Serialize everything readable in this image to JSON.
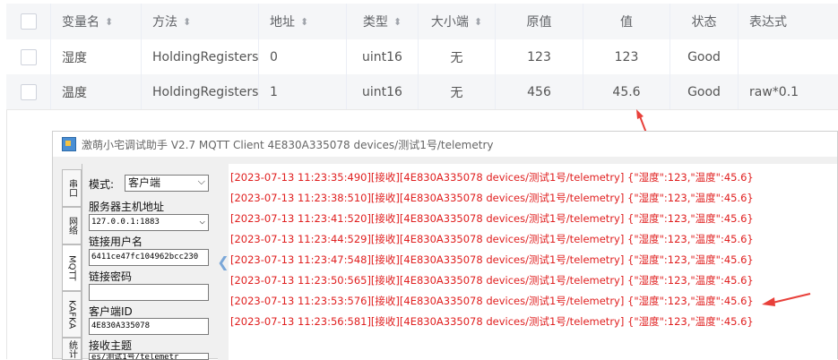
{
  "table": {
    "headers": [
      "变量名",
      "方法",
      "地址",
      "类型",
      "大小端",
      "原值",
      "值",
      "状态",
      "表达式"
    ],
    "rows": [
      {
        "name": "湿度",
        "method": "HoldingRegisters",
        "address": "0",
        "type": "uint16",
        "endian": "无",
        "raw": "123",
        "value": "123",
        "status": "Good",
        "expr": ""
      },
      {
        "name": "温度",
        "method": "HoldingRegisters",
        "address": "1",
        "type": "uint16",
        "endian": "无",
        "raw": "456",
        "value": "45.6",
        "status": "Good",
        "expr": "raw*0.1"
      }
    ]
  },
  "window": {
    "title": "激萌小宅调试助手 V2.7 MQTT Client 4E830A335078 devices/测试1号/telemetry",
    "tabs": [
      "串口",
      "网络",
      "MQTT",
      "KAFKA",
      "统计"
    ],
    "panel": {
      "mode_label": "模式:",
      "mode_value": "客户端",
      "host_label": "服务器主机地址",
      "host_value": "127.0.0.1:1883",
      "user_label": "链接用户名",
      "user_value": "6411ce47fc104962bcc230",
      "password_label": "链接密码",
      "password_value": "",
      "clientid_label": "客户端ID",
      "clientid_value": "4E830A335078",
      "topic_label": "接收主题",
      "topic_value": "es/测试1号/telemetr"
    },
    "log_lines": [
      "[2023-07-13 11:23:35:490][接收][4E830A335078 devices/测试1号/telemetry] {\"湿度\":123,\"温度\":45.6}",
      "[2023-07-13 11:23:38:510][接收][4E830A335078 devices/测试1号/telemetry] {\"湿度\":123,\"温度\":45.6}",
      "[2023-07-13 11:23:41:520][接收][4E830A335078 devices/测试1号/telemetry] {\"湿度\":123,\"温度\":45.6}",
      "[2023-07-13 11:23:44:529][接收][4E830A335078 devices/测试1号/telemetry] {\"湿度\":123,\"温度\":45.6}",
      "[2023-07-13 11:23:47:548][接收][4E830A335078 devices/测试1号/telemetry] {\"湿度\":123,\"温度\":45.6}",
      "[2023-07-13 11:23:50:565][接收][4E830A335078 devices/测试1号/telemetry] {\"湿度\":123,\"温度\":45.6}",
      "[2023-07-13 11:23:53:576][接收][4E830A335078 devices/测试1号/telemetry] {\"湿度\":123,\"温度\":45.6}",
      "[2023-07-13 11:23:56:581][接收][4E830A335078 devices/测试1号/telemetry] {\"湿度\":123,\"温度\":45.6}"
    ]
  },
  "colors": {
    "log_text": "#e02020",
    "arrow": "#e8403a",
    "header_bg": "#f5f6f8"
  }
}
